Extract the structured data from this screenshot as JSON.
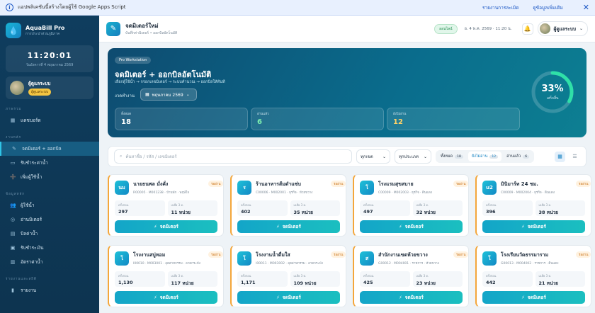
{
  "banner": {
    "message": "แอปพลิเคชันนี้สร้างโดยผู้ใช้ Google Apps Script",
    "report_link": "รายงานการละเมิด",
    "more_link": "ดูข้อมูลเพิ่มเติม"
  },
  "sidebar": {
    "app_name": "AquaBill Pro",
    "app_sub": "การประปาส่วนภูมิภาค",
    "clock_time": "11:20:01",
    "clock_date": "วันอังคารที่ 4 พฤษภาคม 2569",
    "user_name": "ผู้ดูแลระบบ",
    "user_role": "ผู้ดูแลระบบ",
    "sections": [
      {
        "title": "ภาพรวม",
        "items": [
          {
            "label": "แดชบอร์ด",
            "icon": "grid-icon",
            "active": false
          }
        ]
      },
      {
        "title": "งานหลัก",
        "items": [
          {
            "label": "จดมิเตอร์ + ออกบิล",
            "icon": "edit-icon",
            "active": true
          },
          {
            "label": "รับชำระค่าน้ำ",
            "icon": "payment-icon",
            "active": false
          },
          {
            "label": "เพิ่มผู้ใช้น้ำ",
            "icon": "user-add-icon",
            "active": false
          }
        ]
      },
      {
        "title": "ข้อมูลหลัก",
        "items": [
          {
            "label": "ผู้ใช้น้ำ",
            "icon": "users-icon",
            "active": false
          },
          {
            "label": "อ่านมิเตอร์",
            "icon": "meter-icon",
            "active": false
          },
          {
            "label": "บิลค่าน้ำ",
            "icon": "bill-icon",
            "active": false
          },
          {
            "label": "รับชำระเงิน",
            "icon": "cash-icon",
            "active": false
          },
          {
            "label": "อัตราค่าน้ำ",
            "icon": "rate-icon",
            "active": false
          }
        ]
      },
      {
        "title": "รายงานและสถิติ",
        "items": [
          {
            "label": "รายงาน",
            "icon": "chart-icon",
            "active": false
          }
        ]
      }
    ]
  },
  "topbar": {
    "title": "จดมิเตอร์ใหม่",
    "subtitle": "บันทึกค่ามิเตอร์ • ออกบิลอัตโนมัติ",
    "status": "ออนไลน์",
    "date": "อ. 4 พ.ค. 2569 · 11:20 น.",
    "user": "ผู้ดูแลระบบ"
  },
  "hero": {
    "pill": "Pro Workstation",
    "title": "จดมิเตอร์ + ออกบิลอัตโนมัติ",
    "subtitle": "เลือกผู้ใช้น้ำ → กรอกเลขมิเตอร์ → ระบบคำนวณ → ออกบิลให้ทันที",
    "period_label": "งวดทำงาน",
    "period_value": "พฤษภาคม 2569",
    "stats": [
      {
        "label": "ทั้งหมด",
        "value": "18",
        "color": "#ffffff"
      },
      {
        "label": "อ่านแล้ว",
        "value": "6",
        "color": "#7ff0b0"
      },
      {
        "label": "ยังไม่อ่าน",
        "value": "12",
        "color": "#ffd166"
      }
    ],
    "progress_pct": 33,
    "progress_text": "33%",
    "progress_label": "เสร็จสิ้น"
  },
  "filter": {
    "search_placeholder": "ค้นหาชื่อ / รหัส / เลขมิเตอร์",
    "select1": "ทุกเขต",
    "select2": "ทุกประเภท",
    "tabs": [
      {
        "label": "ทั้งหมด",
        "count": "18",
        "on": false
      },
      {
        "label": "ยังไม่อ่าน",
        "count": "12",
        "on": true
      },
      {
        "label": "อ่านแล้ว",
        "count": "6",
        "on": false
      }
    ]
  },
  "cards": [
    {
      "initial": "นม",
      "name": "นายธนพล มั่งคั่ง",
      "meta": "R00005 · M001238 · บ้านพัก · พฤษ์ใจ",
      "badge": "รออ่าน",
      "prev_label": "ครั้งก่อน",
      "prev": "297",
      "avg_label": "เฉลี่ย 3 ด.",
      "avg": "11 หน่วย",
      "button": "จดมิเตอร์"
    },
    {
      "initial": "ร",
      "name": "ร้านอาหารส้มตำแซ่บ",
      "meta": "C00006 · M002001 · ธุรกิจ · หัวยขวาง",
      "badge": "รออ่าน",
      "prev_label": "ครั้งก่อน",
      "prev": "402",
      "avg_label": "เฉลี่ย 3 ด.",
      "avg": "35 หน่วย",
      "button": "จดมิเตอร์"
    },
    {
      "initial": "โ",
      "name": "โรงแรมสุขสบาย",
      "meta": "C00009 · M002003 · ธุรกิจ · ดินแดง",
      "badge": "รออ่าน",
      "prev_label": "ครั้งก่อน",
      "prev": "497",
      "avg_label": "เฉลี่ย 3 ด.",
      "avg": "32 หน่วย",
      "button": "จดมิเตอร์"
    },
    {
      "initial": "u2",
      "name": "มินิมาร์ท 24 ชม.",
      "meta": "C00009 · M002004 · ธุรกิจ · ดินแดง",
      "badge": "รออ่าน",
      "prev_label": "ครั้งก่อน",
      "prev": "396",
      "avg_label": "เฉลี่ย 3 ด.",
      "avg": "38 หน่วย",
      "button": "จดมิเตอร์"
    },
    {
      "initial": "โ",
      "name": "โรงงานสบู่หอม",
      "meta": "I00010 · M003001 · อุตสาหกรรม · ลาดกระบัง",
      "badge": "รออ่าน",
      "prev_label": "ครั้งก่อน",
      "prev": "1,130",
      "avg_label": "เฉลี่ย 3 ด.",
      "avg": "117 หน่วย",
      "button": "จดมิเตอร์"
    },
    {
      "initial": "โ",
      "name": "โรงงานน้ำดื่มใส",
      "meta": "I00011 · M003002 · อุตสาหกรรม · ลาดกระบัง",
      "badge": "รออ่าน",
      "prev_label": "ครั้งก่อน",
      "prev": "1,171",
      "avg_label": "เฉลี่ย 3 ด.",
      "avg": "109 หน่วย",
      "button": "จดมิเตอร์"
    },
    {
      "initial": "ส",
      "name": "สำนักงานเขตห้วยขวาง",
      "meta": "G00012 · M004001 · ราชการ · หัวยขวาง",
      "badge": "รออ่าน",
      "prev_label": "ครั้งก่อน",
      "prev": "425",
      "avg_label": "เฉลี่ย 3 ด.",
      "avg": "23 หน่วย",
      "button": "จดมิเตอร์"
    },
    {
      "initial": "โ",
      "name": "โรงเรียนวัดธรรมาราม",
      "meta": "G00013 · M004002 · ราชการ · ดินแดง",
      "badge": "รออ่าน",
      "prev_label": "ครั้งก่อน",
      "prev": "442",
      "avg_label": "เฉลี่ย 3 ด.",
      "avg": "21 หน่วย",
      "button": "จดมิเตอร์"
    }
  ]
}
